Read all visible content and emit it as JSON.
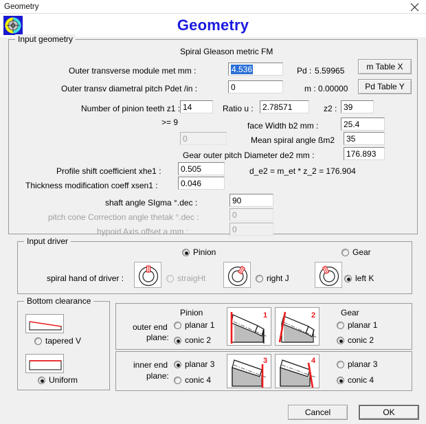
{
  "window": {
    "title": "Geometry",
    "close_icon": "close-icon",
    "app_icon": "gear-compass-icon"
  },
  "banner": {
    "title": "Geometry"
  },
  "input_geometry": {
    "legend": "Input geometry",
    "subtitle": "Spiral   Gleason metric FM",
    "rows": {
      "met_label": "Outer transverse module    met     mm  :",
      "met_value": "4.536",
      "met_readout_label": "Pd :",
      "met_readout_value": "5.59965",
      "pdet_label": "Outer transv diametral pitch    Pdet    /in :",
      "pdet_value": "0",
      "pdet_readout_label": "m :",
      "pdet_readout_value": "0.00000",
      "z1_label": "Number of pinion teeth   z1 :",
      "z1_value": "14",
      "ratio_label": "Ratio   u :",
      "ratio_value": "2.78571",
      "z2_label": "z2 :",
      "z2_value": "39",
      "min_teeth_label": ">=  9",
      "dim_field_value": "0",
      "b2_label": "face Width     b2     mm :",
      "b2_value": "25.4",
      "bm2_label": "Mean spiral angle ßm2",
      "bm2_value": "35",
      "de2_label": "Gear outer pitch Diameter    de2    mm :",
      "de2_value": "176.893",
      "xhe1_label": "Profile shift coefficient   xhe1 :",
      "xhe1_value": "0.505",
      "de2_formula": "d_e2 = m_et * z_2 =  176.904",
      "xsen1_label": "Thickness modification coeff    xsen1 :",
      "xsen1_value": "0.046",
      "sigma_label": "shaft angle    SIgma      °.dec :",
      "sigma_value": "90",
      "thetak_label": "pitch cone Correction angle   thetak   °.dec :",
      "thetak_value": "0",
      "hypoid_label": "hypoid Axis offset      a      mm :",
      "hypoid_value": "0"
    },
    "buttons": {
      "m_table": "m Table X",
      "pd_table": "Pd Table Y"
    }
  },
  "input_driver": {
    "legend": "Input driver",
    "pinion": "Pinion",
    "gear": "Gear",
    "pinion_selected": true,
    "gear_selected": false,
    "spiral_label": "spiral hand of driver :",
    "options": [
      {
        "label": "straigHt",
        "selected": false,
        "disabled": true,
        "icon": "gear-straight-icon"
      },
      {
        "label": "right J",
        "selected": false,
        "disabled": false,
        "icon": "gear-right-hand-icon"
      },
      {
        "label": "left K",
        "selected": true,
        "disabled": false,
        "icon": "gear-left-hand-icon"
      }
    ]
  },
  "bottom_clearance": {
    "legend": "Bottom clearance",
    "options": [
      {
        "label": "tapered V",
        "selected": false,
        "icon": "tapered-clearance-icon"
      },
      {
        "label": "Uniform",
        "selected": true,
        "icon": "uniform-clearance-icon"
      }
    ]
  },
  "end_planes": {
    "outer": {
      "row_label_line1": "outer end",
      "row_label_line2": "plane:",
      "pinion_header": "Pinion",
      "gear_header": "Gear",
      "pinion_options": [
        {
          "label": "planar 1",
          "selected": false
        },
        {
          "label": "conic  2",
          "selected": true
        }
      ],
      "gear_options": [
        {
          "label": "planar 1",
          "selected": false
        },
        {
          "label": "conic  2",
          "selected": true
        }
      ],
      "thumb_left_number": "1",
      "thumb_right_number": "2"
    },
    "inner": {
      "row_label_line1": "inner end",
      "row_label_line2": "plane:",
      "pinion_options": [
        {
          "label": "planar 3",
          "selected": true
        },
        {
          "label": "conic  4",
          "selected": false
        }
      ],
      "gear_options": [
        {
          "label": "planar 3",
          "selected": false
        },
        {
          "label": "conic  4",
          "selected": true
        }
      ],
      "thumb_left_number": "3",
      "thumb_right_number": "4"
    }
  },
  "footer": {
    "cancel": "Cancel",
    "ok": "OK"
  },
  "colors": {
    "accent_blue": "#1a1ae0",
    "selection_blue": "#2a6fd6",
    "diagram_red": "#ee1c1c",
    "window_bg": "#f0f0f0"
  }
}
